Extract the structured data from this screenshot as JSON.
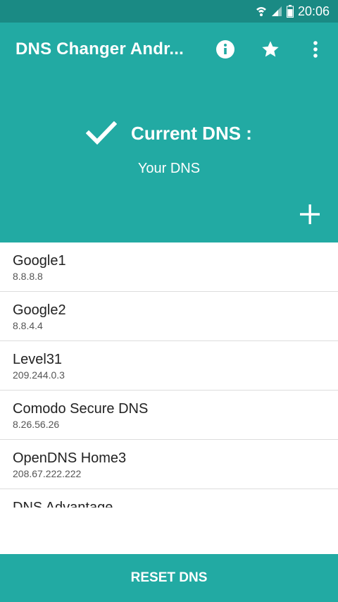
{
  "status_bar": {
    "time": "20:06",
    "icons": [
      "wifi-icon",
      "signal-icon",
      "battery-icon"
    ]
  },
  "app_bar": {
    "title": "DNS Changer Andr...",
    "actions": [
      "info-icon",
      "star-icon",
      "more-vert-icon"
    ]
  },
  "current_dns": {
    "label": "Current DNS :",
    "value": "Your DNS",
    "icon": "check-icon"
  },
  "add_icon": "plus-icon",
  "dns_list": [
    {
      "name": "Google1",
      "ip": "8.8.8.8"
    },
    {
      "name": "Google2",
      "ip": "8.8.4.4"
    },
    {
      "name": "Level31",
      "ip": "209.244.0.3"
    },
    {
      "name": "Comodo Secure DNS",
      "ip": "8.26.56.26"
    },
    {
      "name": "OpenDNS Home3",
      "ip": "208.67.222.222"
    },
    {
      "name": "DNS Advantage",
      "ip": ""
    }
  ],
  "reset_button": {
    "label": "RESET DNS"
  },
  "colors": {
    "primary": "#22aaa3",
    "status_bar": "#1a8a84"
  }
}
